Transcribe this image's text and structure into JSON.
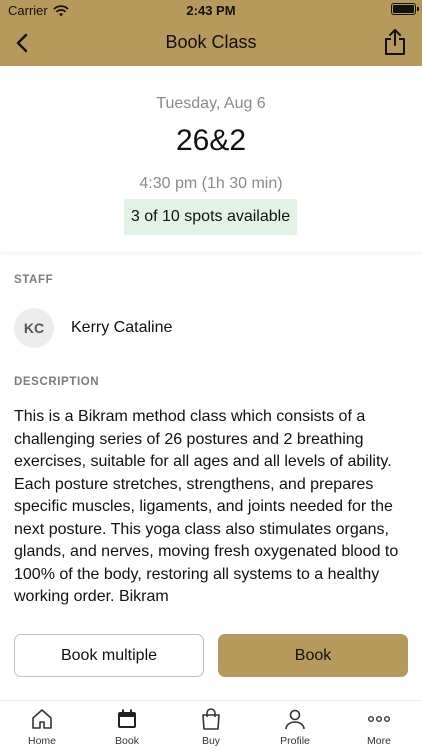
{
  "status_bar": {
    "carrier": "Carrier",
    "time": "2:43 PM"
  },
  "nav": {
    "title": "Book Class",
    "back_icon": "chevron-left-icon",
    "share_icon": "share-icon"
  },
  "class": {
    "date": "Tuesday, Aug 6",
    "name": "26&2",
    "time": "4:30 pm (1h 30 min)",
    "spots": "3 of 10 spots available"
  },
  "staff": {
    "label": "STAFF",
    "initials": "KC",
    "name": "Kerry Cataline"
  },
  "description": {
    "label": "DESCRIPTION",
    "text": "This is a Bikram method class which consists of a challenging series of 26 postures and 2 breathing exercises, suitable for all ages and all levels of ability. Each posture stretches, strengthens, and prepares specific muscles, ligaments, and joints needed for the next posture. This yoga class also stimulates organs, glands, and nerves, moving fresh oxygenated blood to 100% of the body, restoring all systems to a healthy working order. Bikram"
  },
  "actions": {
    "book_multiple": "Book multiple",
    "book": "Book"
  },
  "colors": {
    "accent": "#b5995d",
    "spots_bg": "#e2f3e6"
  },
  "tabs": [
    {
      "label": "Home",
      "icon": "home-icon"
    },
    {
      "label": "Book",
      "icon": "calendar-icon"
    },
    {
      "label": "Buy",
      "icon": "shopping-bag-icon"
    },
    {
      "label": "Profile",
      "icon": "profile-icon"
    },
    {
      "label": "More",
      "icon": "more-icon"
    }
  ]
}
